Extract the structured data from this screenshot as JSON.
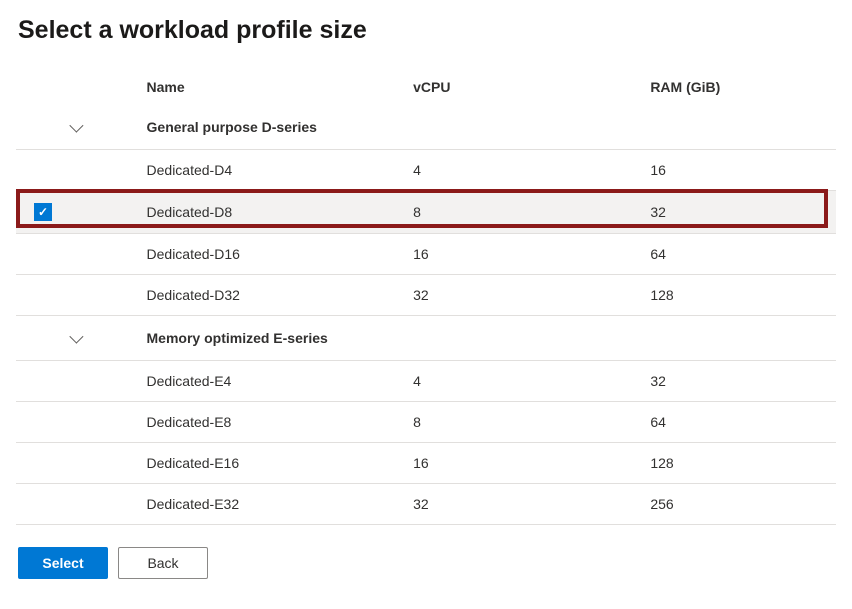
{
  "title": "Select a workload profile size",
  "columns": {
    "name": "Name",
    "vcpu": "vCPU",
    "ram": "RAM (GiB)"
  },
  "groups": [
    {
      "label": "General purpose D-series",
      "rows": [
        {
          "name": "Dedicated-D4",
          "vcpu": "4",
          "ram": "16",
          "selected": false
        },
        {
          "name": "Dedicated-D8",
          "vcpu": "8",
          "ram": "32",
          "selected": true
        },
        {
          "name": "Dedicated-D16",
          "vcpu": "16",
          "ram": "64",
          "selected": false
        },
        {
          "name": "Dedicated-D32",
          "vcpu": "32",
          "ram": "128",
          "selected": false
        }
      ]
    },
    {
      "label": "Memory optimized E-series",
      "rows": [
        {
          "name": "Dedicated-E4",
          "vcpu": "4",
          "ram": "32",
          "selected": false
        },
        {
          "name": "Dedicated-E8",
          "vcpu": "8",
          "ram": "64",
          "selected": false
        },
        {
          "name": "Dedicated-E16",
          "vcpu": "16",
          "ram": "128",
          "selected": false
        },
        {
          "name": "Dedicated-E32",
          "vcpu": "32",
          "ram": "256",
          "selected": false
        }
      ]
    }
  ],
  "buttons": {
    "select": "Select",
    "back": "Back"
  },
  "colors": {
    "primary": "#0078d4",
    "highlight": "#8b1a1a"
  }
}
